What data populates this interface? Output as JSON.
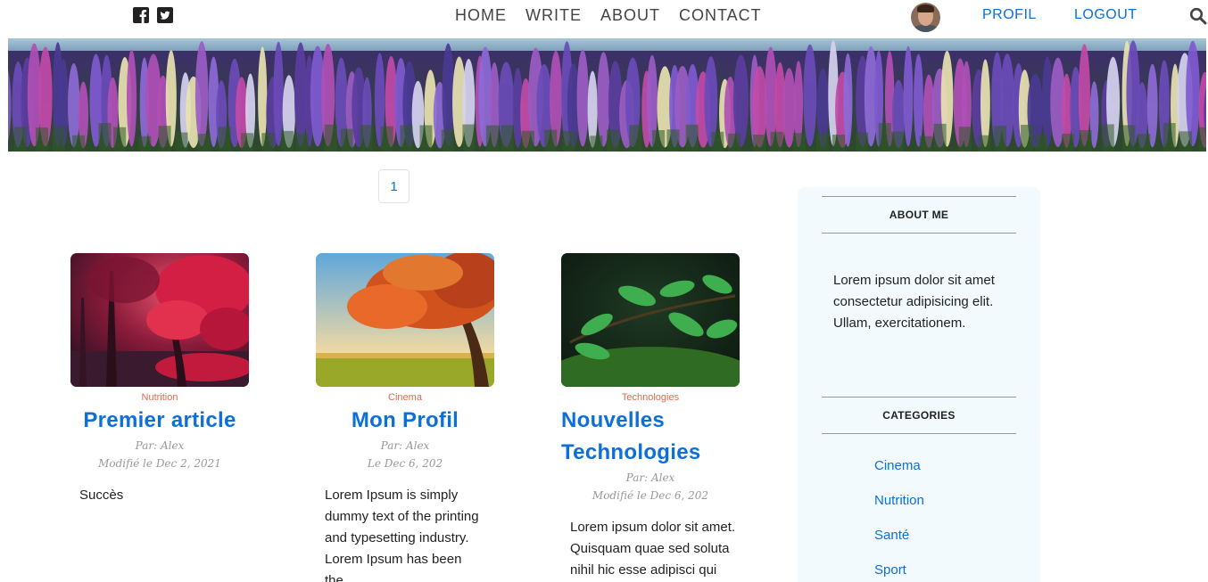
{
  "nav": {
    "links": [
      "HOME",
      "WRITE",
      "ABOUT",
      "CONTACT"
    ],
    "profil_label": "PROFIL",
    "logout_label": "LOGOUT"
  },
  "social": {
    "icons": [
      "facebook-icon",
      "twitter-icon"
    ]
  },
  "pagination": {
    "current": "1"
  },
  "posts": [
    {
      "category": "Nutrition",
      "title": "Premier article",
      "author": "Par: Alex",
      "date": "Modifié le Dec 2, 2021",
      "excerpt": "Succès"
    },
    {
      "category": "Cinema",
      "title": "Mon Profil",
      "author": "Par: Alex",
      "date": "Le Dec 6, 202",
      "excerpt": "Lorem Ipsum is simply dummy text of the printing and typesetting industry. Lorem Ipsum has been the..."
    },
    {
      "category": "Technologies",
      "title": "Nouvelles Technologies",
      "author": "Par: Alex",
      "date": "Modifié le Dec 6, 202",
      "excerpt": "Lorem ipsum dolor sit amet. Quisquam quae sed soluta nihil hic esse adipisci qui"
    }
  ],
  "sidebar": {
    "about_heading": "ABOUT ME",
    "about_text": "Lorem ipsum dolor sit amet consectetur adipisicing elit. Ullam, exercitationem.",
    "categories_heading": "CATEGORIES",
    "categories": [
      "Cinema",
      "Nutrition",
      "Santé",
      "Sport"
    ]
  },
  "colors": {
    "accent": "#0d6fd8",
    "category": "#e06a4c",
    "sidebar_bg": "#f3fafd"
  }
}
